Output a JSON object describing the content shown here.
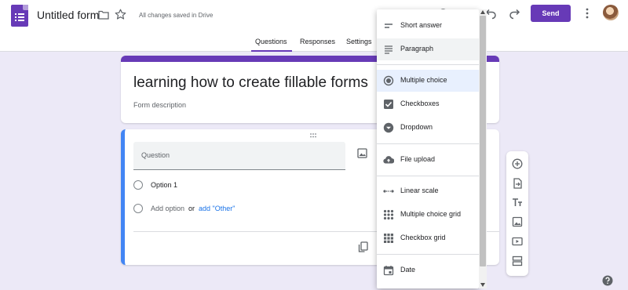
{
  "header": {
    "form_title": "Untitled form",
    "saved_status": "All changes saved in Drive",
    "send_label": "Send"
  },
  "tabs": [
    {
      "label": "Questions",
      "active": true
    },
    {
      "label": "Responses",
      "active": false
    },
    {
      "label": "Settings",
      "active": false
    }
  ],
  "form": {
    "title": "learning how to create fillable forms",
    "description_placeholder": "Form description"
  },
  "question": {
    "placeholder": "Question",
    "option1": "Option 1",
    "add_option": "Add option",
    "or": "or",
    "add_other": "add \"Other\""
  },
  "menu": {
    "items": [
      {
        "label": "Short answer",
        "icon": "short-text-icon"
      },
      {
        "label": "Paragraph",
        "icon": "paragraph-icon"
      },
      {
        "label": "Multiple choice",
        "icon": "radio-checked-icon"
      },
      {
        "label": "Checkboxes",
        "icon": "checkbox-icon"
      },
      {
        "label": "Dropdown",
        "icon": "dropdown-icon"
      },
      {
        "label": "File upload",
        "icon": "cloud-upload-icon"
      },
      {
        "label": "Linear scale",
        "icon": "linear-scale-icon"
      },
      {
        "label": "Multiple choice grid",
        "icon": "grid-icon"
      },
      {
        "label": "Checkbox grid",
        "icon": "grid-icon"
      },
      {
        "label": "Date",
        "icon": "calendar-icon"
      }
    ]
  },
  "colors": {
    "accent": "#673ab7",
    "background": "#ece9f7",
    "focus": "#4285f4",
    "link": "#1a73e8"
  }
}
